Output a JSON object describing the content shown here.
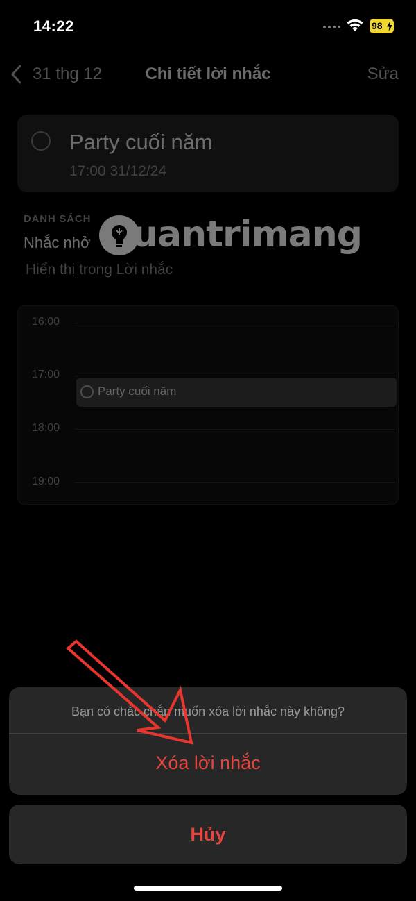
{
  "status_bar": {
    "time": "14:22",
    "battery": "98"
  },
  "nav": {
    "back_label": "31 thg 12",
    "title": "Chi tiết lời nhắc",
    "edit_label": "Sửa"
  },
  "reminder": {
    "title": "Party cuối năm",
    "datetime": "17:00 31/12/24"
  },
  "list": {
    "section_label": "DANH SÁCH",
    "value": "Nhắc nhở",
    "hint": "Hiển thị trong Lời nhắc"
  },
  "watermark": {
    "text": "uantrimang"
  },
  "calendar": {
    "hours": [
      "16:00",
      "17:00",
      "18:00",
      "19:00"
    ],
    "event_title": "Party cuối năm"
  },
  "action_sheet": {
    "message": "Bạn có chắc chắn muốn xóa lời nhắc này không?",
    "delete_label": "Xóa lời nhắc",
    "cancel_label": "Hủy"
  },
  "colors": {
    "destructive": "#e8453e",
    "battery": "#f2d630",
    "sheet_bg": "#272727"
  }
}
